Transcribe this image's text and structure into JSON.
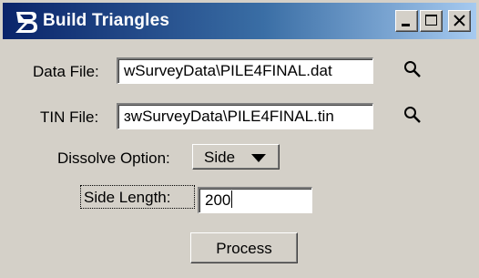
{
  "window": {
    "title": "Build Triangles",
    "buttons": {
      "minimize": "minimize",
      "maximize": "maximize",
      "close": "close"
    }
  },
  "form": {
    "data_file": {
      "label": "Data File:",
      "value": "wSurveyData\\PILE4FINAL.dat",
      "browse_icon": "search-icon"
    },
    "tin_file": {
      "label": "TIN File:",
      "value": "ɜwSurveyData\\PILE4FINAL.tin",
      "browse_icon": "search-icon"
    },
    "dissolve": {
      "label": "Dissolve Option:",
      "selected": "Side"
    },
    "side_length": {
      "label": "Side Length:",
      "value": "200"
    },
    "process_label": "Process"
  },
  "colors": {
    "title_start": "#0a246a",
    "title_end": "#a6caf0",
    "face": "#d4d0c8"
  }
}
